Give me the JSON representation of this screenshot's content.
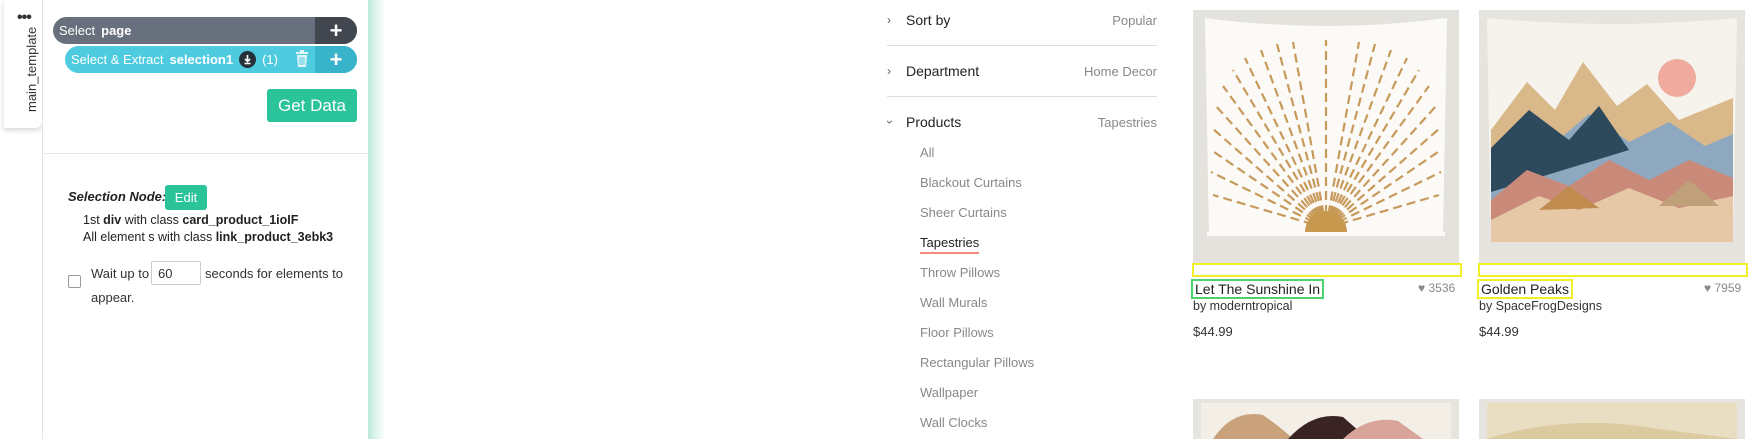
{
  "sidebar_tab": {
    "label": "main_template"
  },
  "commands": {
    "select_page": {
      "prefix": "Select",
      "target": "page"
    },
    "select_extract": {
      "prefix": "Select & Extract",
      "target": "selection1",
      "count": "(1)"
    }
  },
  "get_data_label": "Get Data",
  "selection_node": {
    "label": "Selection Node:",
    "edit_label": "Edit",
    "line1": {
      "prefix": "1st",
      "tag": "div",
      "mid": "with class",
      "cls": "card_product_1ioIF"
    },
    "line2": {
      "prefix": "All element s with class",
      "cls": "link_product_3ebk3"
    }
  },
  "wait": {
    "before": "Wait up to",
    "value": "60",
    "after": "seconds for elements to",
    "line2": "appear."
  },
  "filters": [
    {
      "name": "Sort by",
      "value": "Popular"
    },
    {
      "name": "Department",
      "value": "Home Decor"
    },
    {
      "name": "Products",
      "value": "Tapestries"
    }
  ],
  "product_types": [
    "All",
    "Blackout Curtains",
    "Sheer Curtains",
    "Tapestries",
    "Throw Pillows",
    "Wall Murals",
    "Floor Pillows",
    "Rectangular Pillows",
    "Wallpaper",
    "Wall Clocks"
  ],
  "active_product_type": "Tapestries",
  "products": [
    {
      "title": "Let The Sunshine In",
      "likes": "3536",
      "byline": "by moderntropical",
      "price": "$44.99"
    },
    {
      "title": "Golden Peaks",
      "likes": "7959",
      "byline": "by SpaceFrogDesigns",
      "price": "$44.99"
    }
  ],
  "colors": {
    "accent_green": "#2bc39a",
    "select_page_bg": "#68707d",
    "select_extract_bg": "#4fcbe0",
    "highlight_yellow": "#f2ee27",
    "highlight_green": "#4cd36c",
    "active_underline": "#f08c77"
  }
}
